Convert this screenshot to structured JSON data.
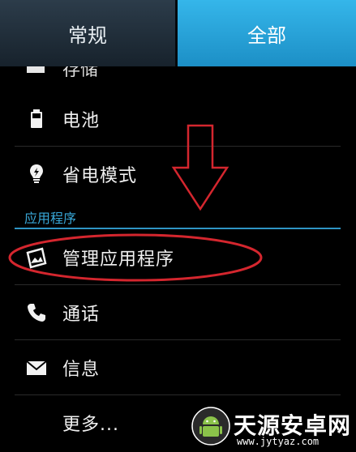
{
  "tabs": [
    {
      "label": "常规",
      "active": false
    },
    {
      "label": "全部",
      "active": true
    }
  ],
  "items": [
    {
      "label": "存储",
      "icon": "storage-icon"
    },
    {
      "label": "电池",
      "icon": "battery-icon"
    },
    {
      "label": "省电模式",
      "icon": "power-saving-icon"
    },
    {
      "label": "管理应用程序",
      "icon": "manage-apps-icon"
    },
    {
      "label": "通话",
      "icon": "phone-icon"
    },
    {
      "label": "信息",
      "icon": "message-icon"
    },
    {
      "label": "更多...",
      "icon": ""
    }
  ],
  "section_title": "应用程序",
  "colors": {
    "accent": "#1c9fd6",
    "annotation": "#d4262e",
    "background": "#000000"
  },
  "watermark": {
    "name": "天源安卓网",
    "url": "www.jytyaz.com"
  }
}
